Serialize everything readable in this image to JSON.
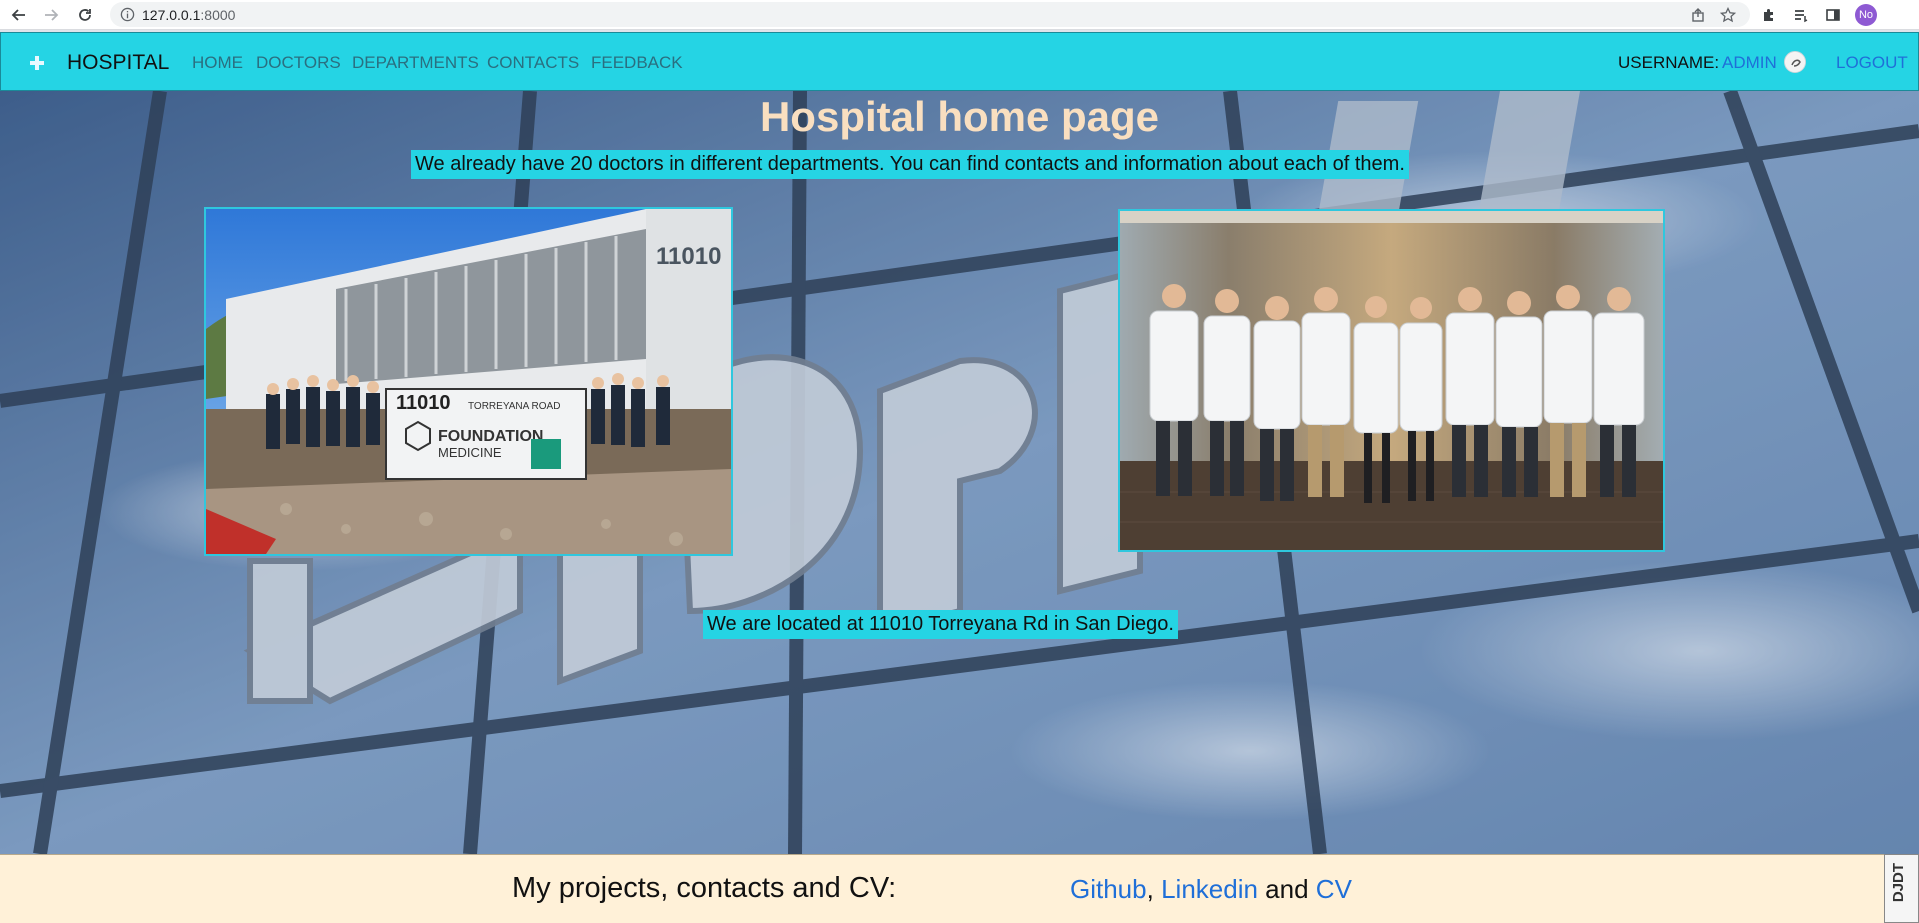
{
  "browser": {
    "url_host": "127.0.0.1",
    "url_port": ":8000",
    "profile_initials": "No"
  },
  "navbar": {
    "brand": "HOSPITAL",
    "links": [
      "HOME",
      "DOCTORS",
      "DEPARTMENTS",
      "CONTACTS",
      "FEEDBACK"
    ],
    "username_label": "USERNAME:",
    "username": "ADMIN",
    "logout": "LOGOUT"
  },
  "main": {
    "title": "Hospital home page",
    "intro": "We already have 20 doctors in different departments. You can find contacts and information about each of them.",
    "location": "We are located at 11010 Torreyana Rd in San Diego.",
    "photo_building": {
      "building_number": "11010",
      "sign_road": "TORREYANA ROAD",
      "sign_brand": "FOUNDATION",
      "sign_brand_sub": "MEDICINE"
    }
  },
  "footer": {
    "label": "My projects, contacts and CV:",
    "links": [
      "Github",
      "Linkedin",
      "CV"
    ],
    "separator_comma": ",",
    "separator_and": "and"
  },
  "debug_toolbar": {
    "label": "DJDT"
  },
  "colors": {
    "navbar": "#25d4e4",
    "link": "#1f6fd8",
    "title": "#f9dfc0",
    "footer": "#fff1d8"
  }
}
